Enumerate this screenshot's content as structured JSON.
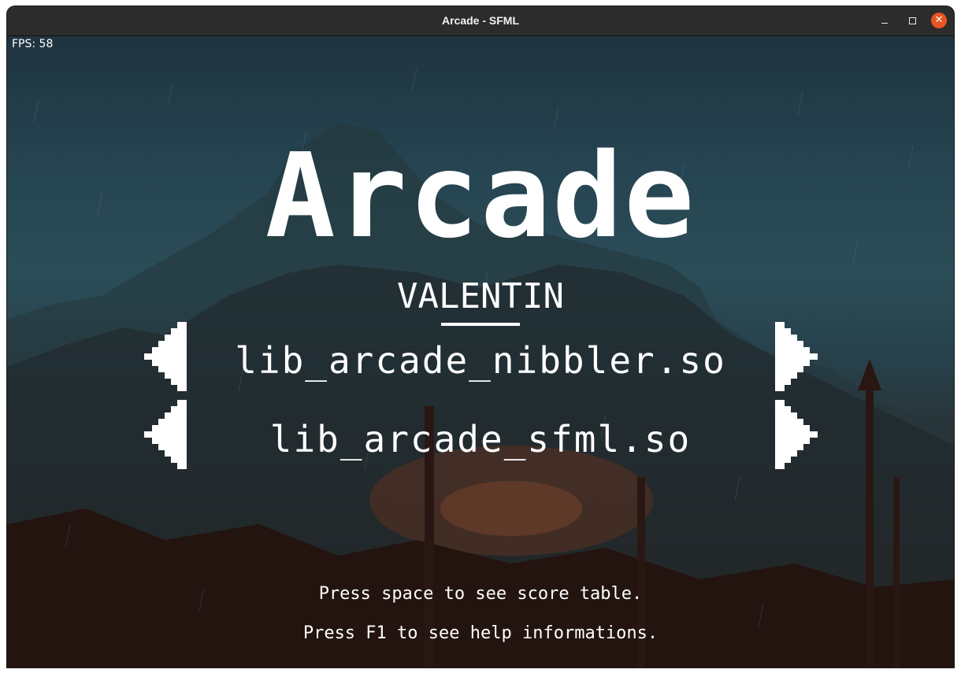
{
  "window": {
    "title": "Arcade - SFML",
    "close_glyph": "✕"
  },
  "hud": {
    "fps": "FPS: 58"
  },
  "menu": {
    "title": "Arcade",
    "player_name": "VALENTIN",
    "game_library": "lib_arcade_nibbler.so",
    "graphics_library": "lib_arcade_sfml.so",
    "hint_score": "Press space to see score table.",
    "hint_help": "Press F1 to see help informations."
  },
  "colors": {
    "titlebar": "#2c2c2c",
    "close_button": "#e95420",
    "text": "#ffffff"
  }
}
